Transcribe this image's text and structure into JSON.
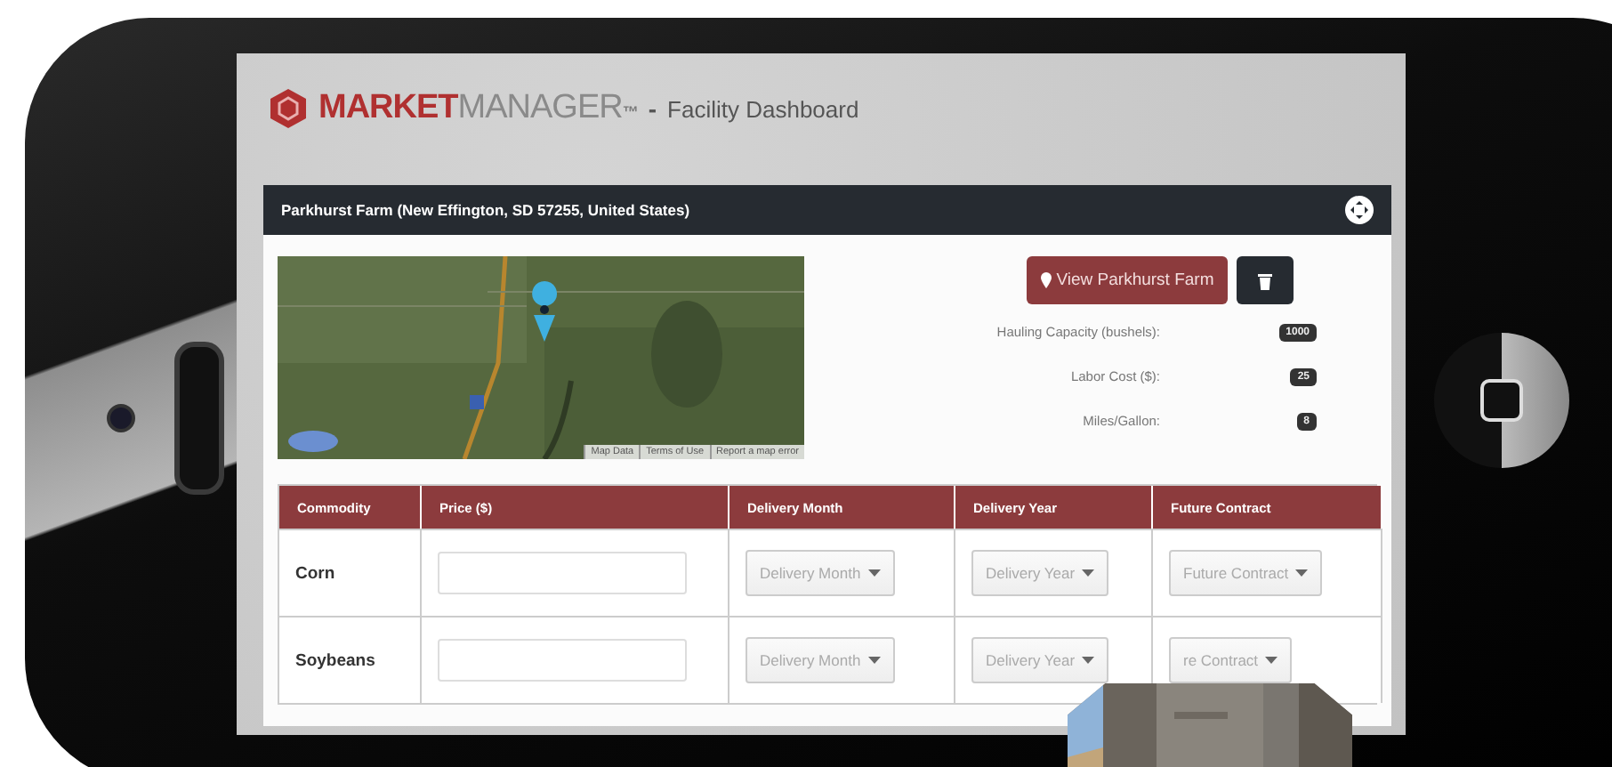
{
  "header": {
    "brand_strong": "MARKET",
    "brand_light": "MANAGER",
    "brand_mark": "™",
    "separator": "-",
    "page_title": "Facility Dashboard"
  },
  "panel": {
    "title": "Parkhurst Farm (New Effington, SD 57255, United States)",
    "map": {
      "kind": "picture",
      "links": [
        "Map Data",
        "Terms of Use",
        "Report a map error"
      ]
    },
    "view_button": "View Parkhurst Farm",
    "stats": [
      {
        "label": "Hauling Capacity (bushels):",
        "value": "1000"
      },
      {
        "label": "Labor Cost ($):",
        "value": "25"
      },
      {
        "label": "Miles/Gallon:",
        "value": "8"
      }
    ]
  },
  "table": {
    "columns": [
      "Commodity",
      "Price ($)",
      "Delivery Month",
      "Delivery Year",
      "Future Contract"
    ],
    "rows": [
      {
        "commodity": "Corn",
        "month": "Delivery Month",
        "year": "Delivery Year",
        "contract": "Future Contract"
      },
      {
        "commodity": "Soybeans",
        "month": "Delivery Month",
        "year": "Delivery Year",
        "contract": "re Contract"
      }
    ]
  }
}
